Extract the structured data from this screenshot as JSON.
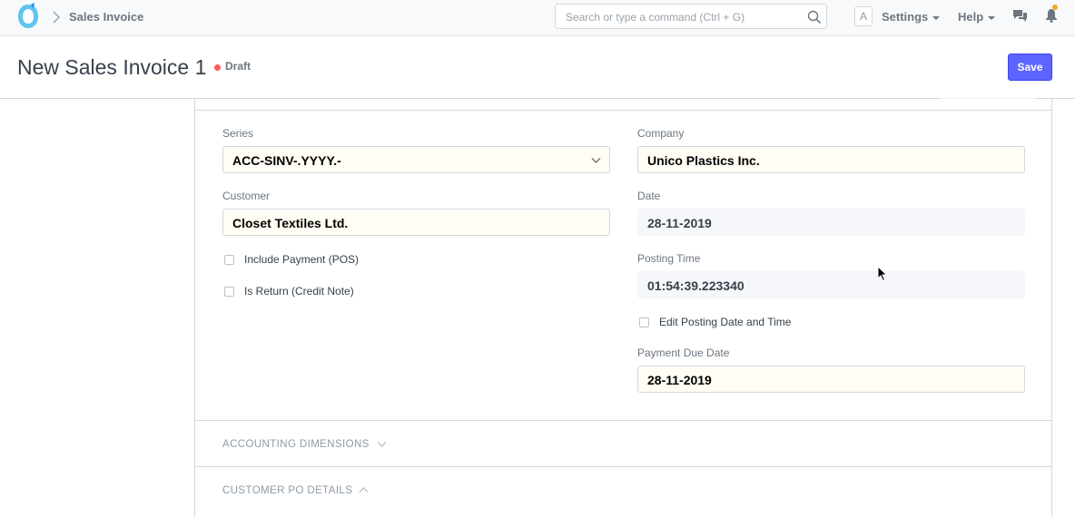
{
  "navbar": {
    "breadcrumb": "Sales Invoice",
    "search_placeholder": "Search or type a command (Ctrl + G)",
    "avatar_initial": "A",
    "settings_label": "Settings",
    "help_label": "Help",
    "icons": [
      "logo-icon",
      "chevron-right-icon",
      "search-icon",
      "chat-icon",
      "bell-icon"
    ],
    "notification_color": "#f5a623"
  },
  "page": {
    "title": "New Sales Invoice 1",
    "status": "Draft",
    "status_color": "#ff5858",
    "save_label": "Save",
    "accent": "#5e64ff"
  },
  "form": {
    "left": {
      "series_label": "Series",
      "series_value": "ACC-SINV-.YYYY.-",
      "customer_label": "Customer",
      "customer_value": "Closet Textiles Ltd.",
      "include_payment_label": "Include Payment (POS)",
      "is_return_label": "Is Return (Credit Note)"
    },
    "right": {
      "company_label": "Company",
      "company_value": "Unico Plastics Inc.",
      "date_label": "Date",
      "date_value": "28-11-2019",
      "posting_time_label": "Posting Time",
      "posting_time_value": "01:54:39.223340",
      "edit_posting_label": "Edit Posting Date and Time",
      "payment_due_label": "Payment Due Date",
      "payment_due_value": "28-11-2019"
    },
    "sections": {
      "accounting_dimensions": "ACCOUNTING DIMENSIONS",
      "customer_po_details": "CUSTOMER PO DETAILS"
    }
  }
}
